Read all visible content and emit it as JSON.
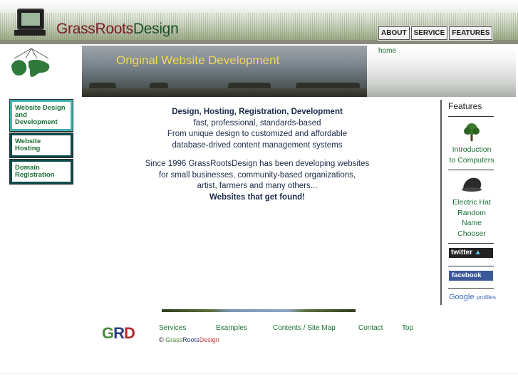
{
  "header": {
    "site_name_part1": "Grass",
    "site_name_part2": "Roots",
    "site_name_part3": "Design",
    "nav": [
      {
        "label": "ABOUT"
      },
      {
        "label": "SERVICE"
      },
      {
        "label": "FEATURES"
      }
    ]
  },
  "banner": {
    "title": "Original Website Development",
    "breadcrumb": "home"
  },
  "left_nav": {
    "items": [
      {
        "label": "Website Design and Development"
      },
      {
        "label": "Website Hosting"
      },
      {
        "label": "Domain Registration"
      }
    ]
  },
  "content": {
    "headline": "Design, Hosting, Registration, Development",
    "line2": "fast, professional, standards-based",
    "line3": "From unique design to customized and affordable",
    "line4": "database-drived content management systems",
    "para2_line1": "Since 1996 GrassRootsDesign has been developing websites",
    "para2_line2": "for small businesses, community-based organizations,",
    "para2_line3": "artist, farmers and many others...",
    "tagline": "Websites that get found!"
  },
  "features": {
    "title": "Features",
    "item1_line1": "Introduction",
    "item1_line2": "to Computers",
    "item2_line1": "Electric Hat",
    "item2_line2": "Random",
    "item2_line3": "Name",
    "item2_line4": "Chooser",
    "twitter_label": "twitter",
    "facebook_label": "facebook",
    "google_label": "Google",
    "google_profiles_label": "profiles"
  },
  "footer": {
    "logo_g": "G",
    "logo_r": "R",
    "logo_d": "D",
    "links": [
      {
        "label": "Services"
      },
      {
        "label": "Examples"
      },
      {
        "label": "Contents / Site Map"
      },
      {
        "label": "Contact"
      },
      {
        "label": "Top"
      }
    ],
    "copyright_symbol": "©",
    "copyright_grass": "Grass",
    "copyright_roots": "Roots",
    "copyright_design": "Design"
  },
  "colors": {
    "link_green": "#1b6e37",
    "banner_title": "#f0d85a",
    "nav_border": "#43b0b0"
  }
}
